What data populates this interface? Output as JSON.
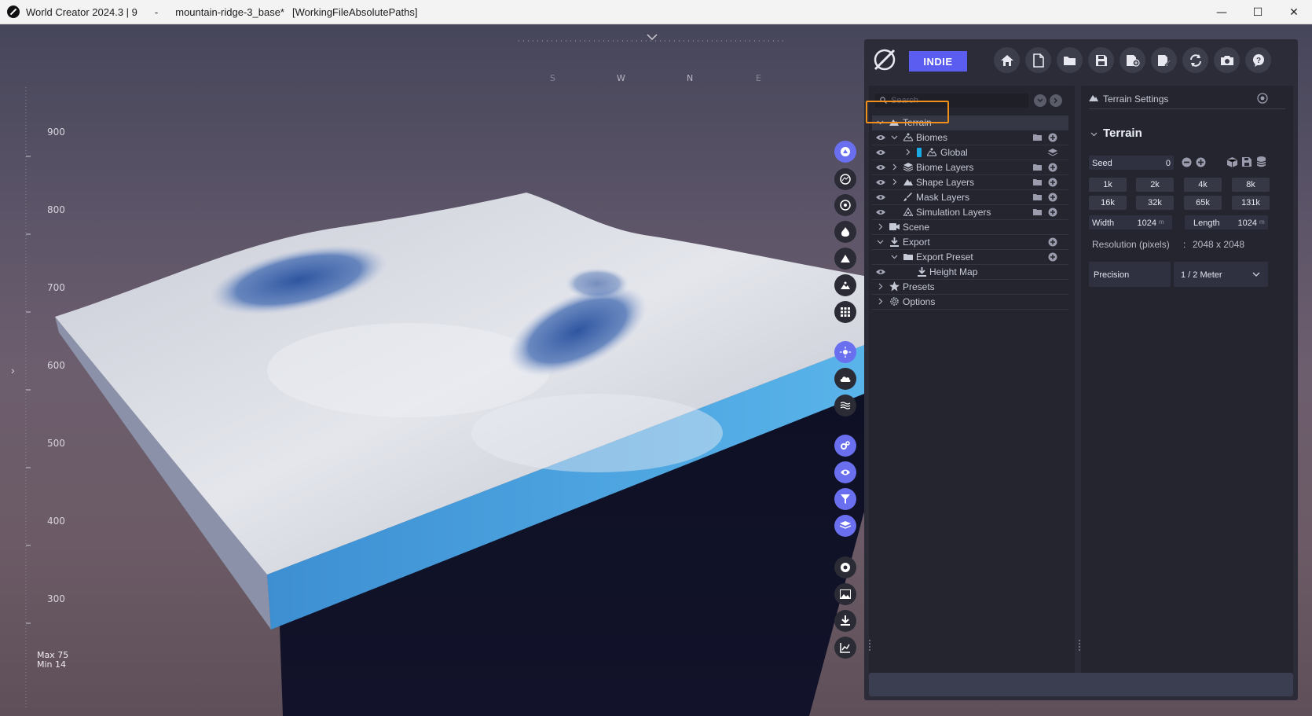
{
  "titlebar": {
    "app": "World Creator 2024.3 | 9",
    "sep": "-",
    "file": "mountain-ridge-3_base*",
    "extra": "[WorkingFileAbsolutePaths]",
    "minimize": "—",
    "maximize": "☐",
    "close": "✕"
  },
  "viewport": {
    "compass": [
      "S",
      "W",
      "N",
      "E"
    ],
    "ruler_labels": [
      "900",
      "800",
      "700",
      "600",
      "500",
      "400",
      "300"
    ],
    "max_label": "Max 75",
    "min_label": "Min 14",
    "expand_arrow": "›"
  },
  "toolbar": {
    "indie_label": "INDIE",
    "buttons": [
      "home-icon",
      "new-file-icon",
      "open-folder-icon",
      "save-icon",
      "save-add-icon",
      "save-edit-icon",
      "refresh-icon",
      "camera-icon",
      "help-icon"
    ]
  },
  "tree": {
    "search_placeholder": "Search",
    "rows": {
      "terrain": "Terrain",
      "biomes": "Biomes",
      "global": "Global",
      "biome_layers": "Biome Layers",
      "shape_layers": "Shape Layers",
      "mask_layers": "Mask Layers",
      "simulation_layers": "Simulation Layers",
      "scene": "Scene",
      "export": "Export",
      "export_preset": "Export Preset",
      "height_map": "Height Map",
      "presets": "Presets",
      "options": "Options"
    }
  },
  "settings": {
    "header": "Terrain Settings",
    "section": "Terrain",
    "seed_label": "Seed",
    "seed_value": "0",
    "resolutions": [
      "1k",
      "2k",
      "4k",
      "8k",
      "16k",
      "32k",
      "65k",
      "131k"
    ],
    "width_label": "Width",
    "width_value": "1024",
    "length_label": "Length",
    "length_value": "1024",
    "unit": "m",
    "resolution_label": "Resolution (pixels)",
    "resolution_sep": ":",
    "resolution_value": "2048 x 2048",
    "precision_label": "Precision",
    "precision_value": "1 / 2 Meter"
  },
  "colors": {
    "accent": "#5b5cf0",
    "highlight": "#f0901a",
    "panel_bg": "#2b2c37",
    "water": "#4aa3e0"
  }
}
